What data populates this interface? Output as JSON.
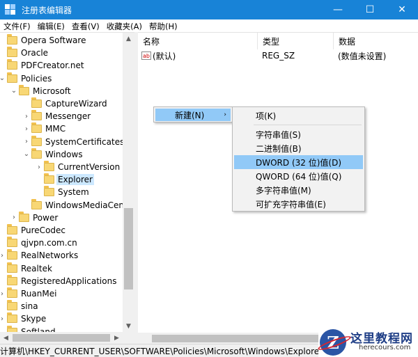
{
  "window": {
    "title": "注册表编辑器",
    "minimize": "—",
    "maximize": "☐",
    "close": "✕"
  },
  "menubar": [
    "文件(F)",
    "编辑(E)",
    "查看(V)",
    "收藏夹(A)",
    "帮助(H)"
  ],
  "tree": {
    "nodes": [
      {
        "label": "Opera Software",
        "level": 0,
        "arrow": ""
      },
      {
        "label": "Oracle",
        "level": 0,
        "arrow": ""
      },
      {
        "label": "PDFCreator.net",
        "level": 0,
        "arrow": ""
      },
      {
        "label": "Policies",
        "level": 0,
        "arrow": "⌄"
      },
      {
        "label": "Microsoft",
        "level": 1,
        "arrow": "⌄"
      },
      {
        "label": "CaptureWizard",
        "level": 2,
        "arrow": ""
      },
      {
        "label": "Messenger",
        "level": 2,
        "arrow": "›"
      },
      {
        "label": "MMC",
        "level": 2,
        "arrow": "›"
      },
      {
        "label": "SystemCertificates",
        "level": 2,
        "arrow": "›"
      },
      {
        "label": "Windows",
        "level": 2,
        "arrow": "⌄"
      },
      {
        "label": "CurrentVersion",
        "level": 3,
        "arrow": "›"
      },
      {
        "label": "Explorer",
        "level": 3,
        "arrow": "",
        "selected": true
      },
      {
        "label": "System",
        "level": 3,
        "arrow": ""
      },
      {
        "label": "WindowsMediaCenter",
        "level": 2,
        "arrow": ""
      },
      {
        "label": "Power",
        "level": 1,
        "arrow": "›"
      },
      {
        "label": "PureCodec",
        "level": 0,
        "arrow": ""
      },
      {
        "label": "qjvpn.com.cn",
        "level": 0,
        "arrow": ""
      },
      {
        "label": "RealNetworks",
        "level": 0,
        "arrow": "›"
      },
      {
        "label": "Realtek",
        "level": 0,
        "arrow": ""
      },
      {
        "label": "RegisteredApplications",
        "level": 0,
        "arrow": ""
      },
      {
        "label": "RuanMei",
        "level": 0,
        "arrow": "›"
      },
      {
        "label": "sina",
        "level": 0,
        "arrow": ""
      },
      {
        "label": "Skype",
        "level": 0,
        "arrow": "›"
      },
      {
        "label": "Softland",
        "level": 0,
        "arrow": ""
      }
    ]
  },
  "list": {
    "columns": [
      "名称",
      "类型",
      "数据"
    ],
    "rows": [
      {
        "icon": "ab",
        "name": "(默认)",
        "type": "REG_SZ",
        "data": "(数值未设置)"
      }
    ]
  },
  "context_menu": {
    "parent_item": "新建(N)",
    "submenu_arrow": "›",
    "items": [
      {
        "label": "项(K)"
      },
      {
        "label": "字符串值(S)"
      },
      {
        "label": "二进制值(B)"
      },
      {
        "label": "DWORD (32 位)值(D)",
        "highlighted": true
      },
      {
        "label": "QWORD (64 位)值(Q)"
      },
      {
        "label": "多字符串值(M)"
      },
      {
        "label": "可扩充字符串值(E)"
      }
    ]
  },
  "statusbar": {
    "path": "计算机\\HKEY_CURRENT_USER\\SOFTWARE\\Policies\\Microsoft\\Windows\\Explorer"
  },
  "watermark": {
    "letter": "Z",
    "name": "这里教程网",
    "url": "herecours.com"
  }
}
